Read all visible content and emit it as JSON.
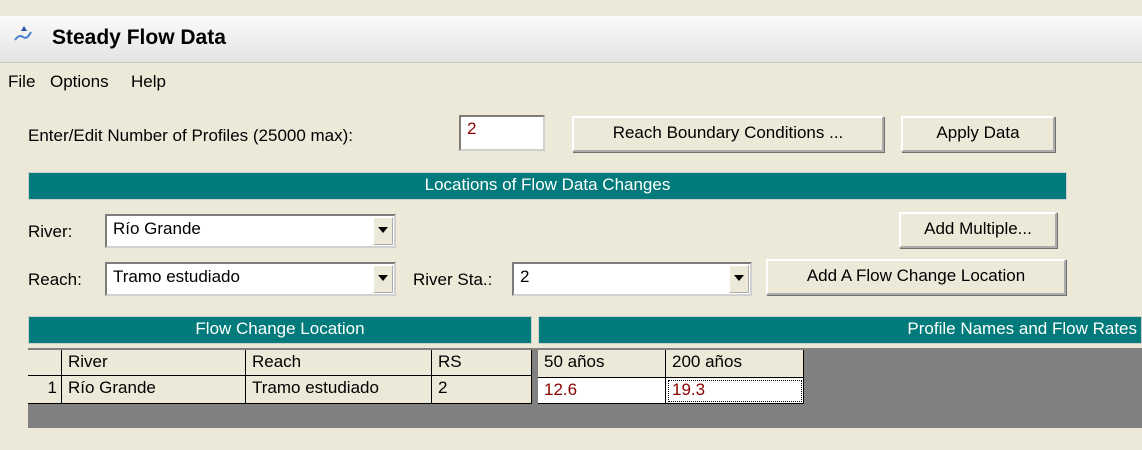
{
  "window": {
    "title": "Steady Flow Data"
  },
  "menu": [
    "File",
    "Options",
    "Help"
  ],
  "profiles": {
    "label": "Enter/Edit Number of Profiles (25000 max):",
    "value": "2",
    "reach_bc_button": "Reach Boundary Conditions ...",
    "apply_button": "Apply Data"
  },
  "locations": {
    "band": "Locations of Flow Data Changes",
    "river_label": "River:",
    "river_value": "Río Grande",
    "add_multiple_button": "Add Multiple...",
    "reach_label": "Reach:",
    "reach_value": "Tramo estudiado",
    "river_sta_label": "River Sta.:",
    "river_sta_value": "2",
    "add_location_button": "Add A Flow Change Location"
  },
  "table": {
    "band_left": "Flow Change Location",
    "band_right": "Profile Names and Flow Rates",
    "headers": [
      "River",
      "Reach",
      "RS",
      "50 años",
      "200 años"
    ],
    "rows": [
      {
        "num": "1",
        "river": "Río Grande",
        "reach": "Tramo estudiado",
        "rs": "2",
        "q1": "12.6",
        "q2": "19.3"
      }
    ]
  },
  "colors": {
    "band": "#007a7a",
    "value_text": "#8a0000"
  }
}
